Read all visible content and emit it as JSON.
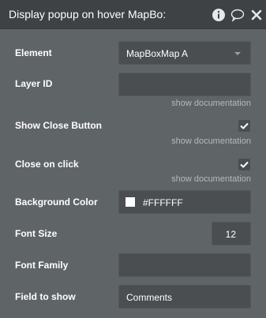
{
  "header": {
    "title": "Display popup on hover MapBo:",
    "icons": [
      "info-icon",
      "comment-icon",
      "close-icon"
    ]
  },
  "fields": {
    "element": {
      "label": "Element",
      "value": "MapBoxMap A"
    },
    "layer_id": {
      "label": "Layer ID",
      "value": "",
      "doc": "show documentation"
    },
    "show_close_button": {
      "label": "Show Close Button",
      "checked": true,
      "doc": "show documentation"
    },
    "close_on_click": {
      "label": "Close on click",
      "checked": true,
      "doc": "show documentation"
    },
    "background_color": {
      "label": "Background Color",
      "value": "#FFFFFF"
    },
    "font_size": {
      "label": "Font Size",
      "value": "12"
    },
    "font_family": {
      "label": "Font Family",
      "value": ""
    },
    "field_to_show": {
      "label": "Field to show",
      "value": "Comments"
    }
  },
  "colors": {
    "panel_bg": "#5f6467",
    "header_bg": "#3e4245",
    "input_bg": "#4a4e51",
    "doc_text": "#b4b9bc"
  }
}
